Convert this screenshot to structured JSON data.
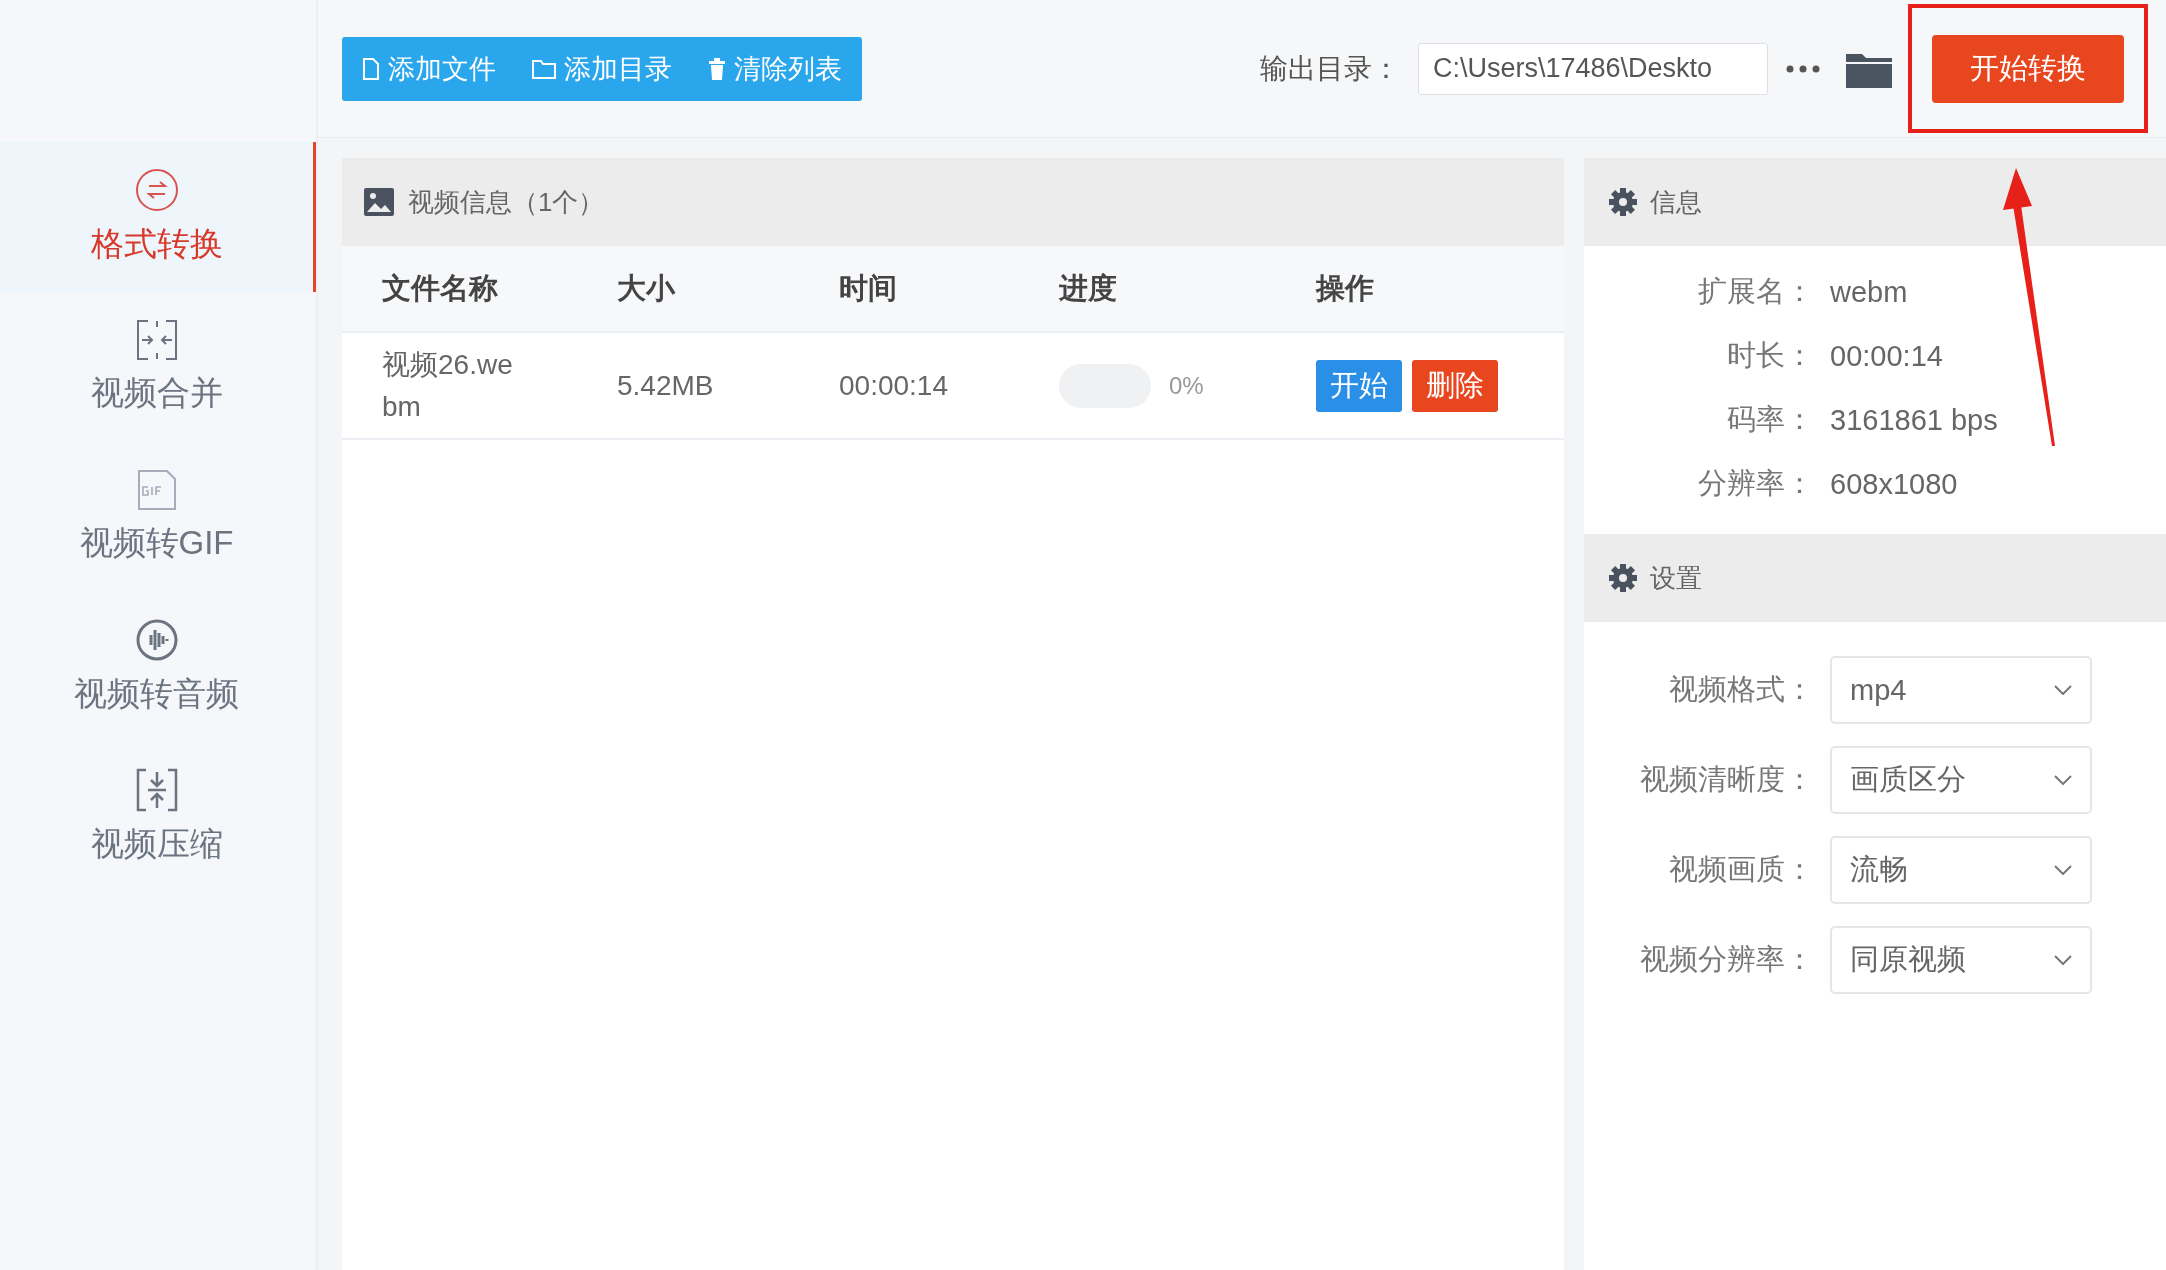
{
  "toolbar": {
    "buttons": [
      {
        "label": "添加文件"
      },
      {
        "label": "添加目录"
      },
      {
        "label": "清除列表"
      }
    ],
    "output": {
      "label": "输出目录：",
      "value": "C:\\Users\\17486\\Deskto"
    },
    "start_button": "开始转换"
  },
  "sidebar": {
    "items": [
      {
        "label": "格式转换",
        "selected": true
      },
      {
        "label": "视频合并",
        "selected": false
      },
      {
        "label": "视频转GIF",
        "selected": false
      },
      {
        "label": "视频转音频",
        "selected": false
      },
      {
        "label": "视频压缩",
        "selected": false
      }
    ]
  },
  "file_panel": {
    "title": "视频信息（1个）",
    "columns": [
      "文件名称",
      "大小",
      "时间",
      "进度",
      "操作"
    ],
    "rows": [
      {
        "file_name": "视频26.webm",
        "size": "5.42MB",
        "time": "00:00:14",
        "progress": {
          "level": 0,
          "reading": "0%"
        },
        "actions": [
          {
            "label": "开始",
            "kind": "start"
          },
          {
            "label": "删除",
            "kind": "delete"
          }
        ]
      }
    ]
  },
  "info": {
    "title": "信息",
    "fields": [
      {
        "label": "扩展名：",
        "value": "webm"
      },
      {
        "label": "时长：",
        "value": "00:00:14"
      },
      {
        "label": "码率：",
        "value": "3161861 bps"
      },
      {
        "label": "分辨率：",
        "value": "608x1080"
      }
    ]
  },
  "settings": {
    "title": "设置",
    "fields": [
      {
        "label": "视频格式：",
        "value": "mp4"
      },
      {
        "label": "视频清晰度：",
        "value": "画质区分"
      },
      {
        "label": "视频画质：",
        "value": "流畅"
      },
      {
        "label": "视频分辨率：",
        "value": "同原视频"
      }
    ]
  }
}
